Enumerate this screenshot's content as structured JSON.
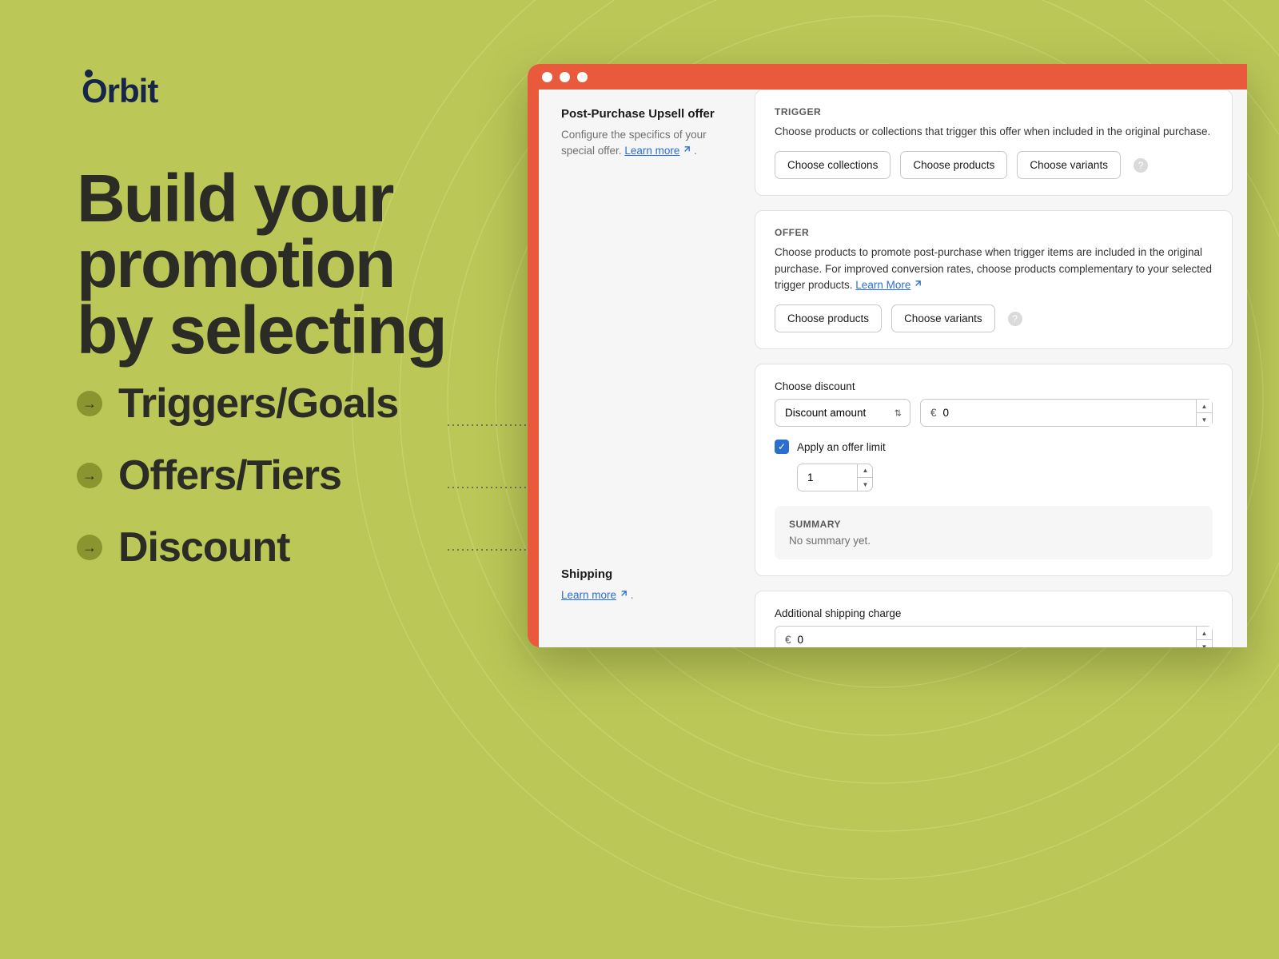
{
  "brand": "Orbit",
  "headline": [
    "Build your",
    "promotion",
    "by selecting"
  ],
  "bullets": [
    "Triggers/Goals",
    "Offers/Tiers",
    "Discount"
  ],
  "left": {
    "section1": {
      "title": "Post-Purchase Upsell offer",
      "desc": "Configure the specifics of your special offer. ",
      "link": "Learn more"
    },
    "section2": {
      "title": "Shipping",
      "link": "Learn more"
    }
  },
  "trigger": {
    "label": "TRIGGER",
    "desc": "Choose products or collections that trigger this offer when included in the original purchase.",
    "btn1": "Choose collections",
    "btn2": "Choose products",
    "btn3": "Choose variants"
  },
  "offer": {
    "label": "OFFER",
    "desc": "Choose products to promote post-purchase when trigger items are included in the original purchase. For improved conversion rates, choose products complementary to your selected trigger products. ",
    "link": "Learn More",
    "btn1": "Choose products",
    "btn2": "Choose variants"
  },
  "discount": {
    "label": "Choose discount",
    "type": "Discount amount",
    "cur": "€",
    "val": "0",
    "apply": "Apply an offer limit",
    "limit": "1",
    "sum_lbl": "SUMMARY",
    "sum_txt": "No summary yet."
  },
  "shipping": {
    "label": "Additional shipping charge",
    "cur": "€",
    "val": "0"
  }
}
